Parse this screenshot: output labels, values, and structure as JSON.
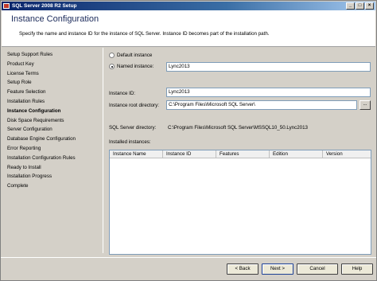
{
  "window": {
    "title": "SQL Server 2008 R2 Setup",
    "controls": {
      "minimize": "_",
      "maximize": "□",
      "close": "×"
    }
  },
  "header": {
    "title": "Instance Configuration",
    "subtitle": "Specify the name and instance ID for the instance of SQL Server. Instance ID becomes part of the installation path."
  },
  "sidebar": {
    "items": [
      {
        "label": "Setup Support Rules",
        "active": false
      },
      {
        "label": "Product Key",
        "active": false
      },
      {
        "label": "License Terms",
        "active": false
      },
      {
        "label": "Setup Role",
        "active": false
      },
      {
        "label": "Feature Selection",
        "active": false
      },
      {
        "label": "Installation Rules",
        "active": false
      },
      {
        "label": "Instance Configuration",
        "active": true
      },
      {
        "label": "Disk Space Requirements",
        "active": false
      },
      {
        "label": "Server Configuration",
        "active": false
      },
      {
        "label": "Database Engine Configuration",
        "active": false
      },
      {
        "label": "Error Reporting",
        "active": false
      },
      {
        "label": "Installation Configuration Rules",
        "active": false
      },
      {
        "label": "Ready to Install",
        "active": false
      },
      {
        "label": "Installation Progress",
        "active": false
      },
      {
        "label": "Complete",
        "active": false
      }
    ]
  },
  "instance": {
    "default_label": "Default instance",
    "named_label": "Named instance:",
    "named_value": "Lync2013",
    "selected": "named",
    "id_label": "Instance ID:",
    "id_value": "Lync2013",
    "root_label": "Instance root directory:",
    "root_value": "C:\\Program Files\\Microsoft SQL Server\\",
    "browse_label": "...",
    "sql_dir_label": "SQL Server directory:",
    "sql_dir_value": "C:\\Program Files\\Microsoft SQL Server\\MSSQL10_50.Lync2013",
    "installed_label": "Installed instances:"
  },
  "installed_table": {
    "columns": [
      "Instance Name",
      "Instance ID",
      "Features",
      "Edition",
      "Version"
    ],
    "rows": []
  },
  "footer": {
    "back": "< Back",
    "next": "Next >",
    "cancel": "Cancel",
    "help": "Help"
  }
}
